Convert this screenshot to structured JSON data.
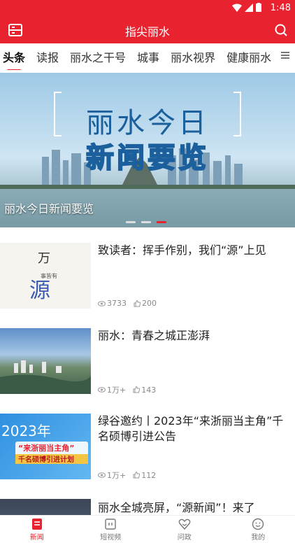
{
  "status_bar": {
    "time": "1:48",
    "icons": [
      "wifi-icon",
      "signal-icon",
      "battery-icon"
    ]
  },
  "app_bar": {
    "title": "指尖丽水",
    "left_icon": "card-icon",
    "right_icon": "search-icon"
  },
  "tabs": {
    "items": [
      "头条",
      "读报",
      "丽水之干号",
      "城事",
      "丽水视界",
      "健康丽水"
    ],
    "active_index": 0,
    "menu_icon": "menu-icon"
  },
  "banner": {
    "image_text_line1": "丽水今日",
    "image_text_line2": "新闻要览",
    "caption": "丽水今日新闻要览",
    "slide_count": 3,
    "active_slide": 2
  },
  "news": [
    {
      "title": "致读者：挥手作别，我们“源”上见",
      "views": "3733",
      "likes": "200",
      "thumb_text": "源",
      "thumb_text_top": "万",
      "thumb_text_small": "事皆有"
    },
    {
      "title": "丽水：青春之城正澎湃",
      "views": "1万+",
      "likes": "143"
    },
    {
      "title": "绿谷邀约丨2023年“来浙丽当主角”千名硕博引进公告",
      "views": "1万+",
      "likes": "112",
      "thumb_text": "2023年",
      "thumb_text2": "“来浙丽当主角”",
      "thumb_text3": "千名硕博引进计划"
    },
    {
      "title": "丽水全城亮屏，“源新闻”！来了",
      "views": "",
      "likes": ""
    }
  ],
  "bottom_nav": [
    {
      "label": "新闻",
      "icon": "news-icon",
      "active": true
    },
    {
      "label": "短视频",
      "icon": "video-icon",
      "active": false
    },
    {
      "label": "问政",
      "icon": "heart-icon",
      "active": false
    },
    {
      "label": "我的",
      "icon": "profile-icon",
      "active": false
    }
  ],
  "colors": {
    "accent": "#e8232f"
  }
}
